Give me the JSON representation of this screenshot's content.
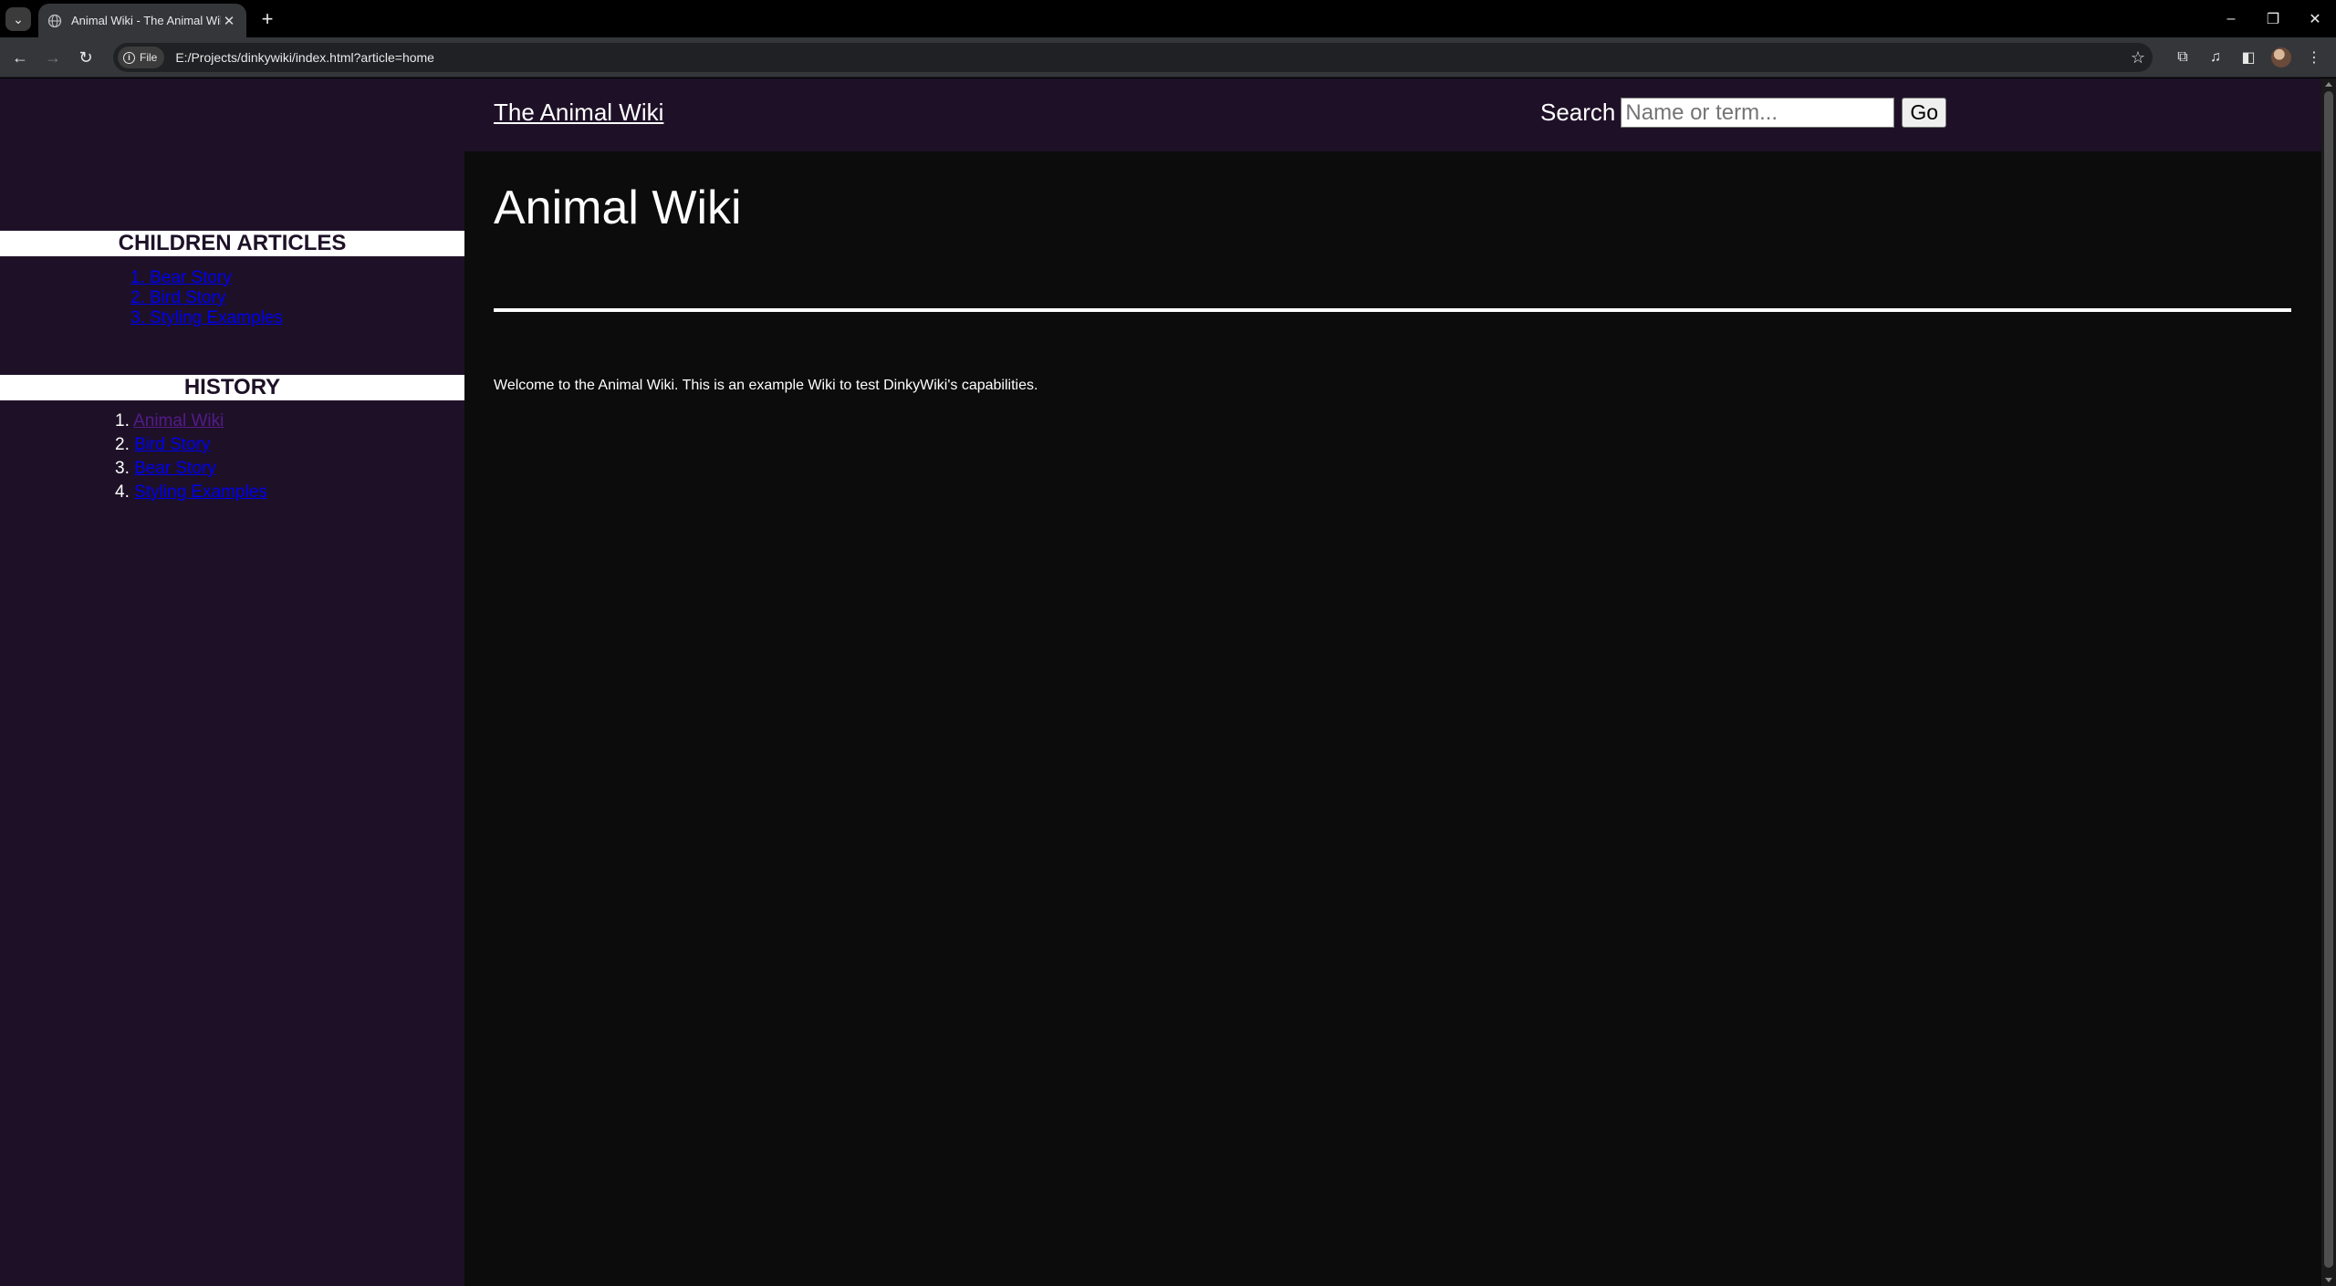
{
  "browser": {
    "tab_title": "Animal Wiki - The Animal Wiki",
    "tab_close": "✕",
    "new_tab": "+",
    "chip_label": "File",
    "url": "E:/Projects/dinkywiki/index.html?article=home",
    "icons": [
      "tab-list-icon",
      "globe-icon",
      "back-icon",
      "forward-icon",
      "reload-icon",
      "info-icon",
      "star-icon",
      "extensions-icon",
      "media-icon",
      "side-panel-icon",
      "profile-avatar",
      "menu-icon",
      "minimize-icon",
      "restore-icon",
      "close-icon"
    ]
  },
  "header": {
    "site_title": "The Animal Wiki",
    "search_label": "Search",
    "search_placeholder": "Name or term...",
    "search_value": "",
    "go_label": "Go"
  },
  "sidebar": {
    "children_heading": "CHILDREN ARTICLES",
    "children": [
      {
        "num": "1.",
        "label": "Bear Story"
      },
      {
        "num": "2.",
        "label": "Bird Story"
      },
      {
        "num": "3.",
        "label": "Styling Examples"
      }
    ],
    "history_heading": "HISTORY",
    "history": [
      {
        "num": "1.",
        "label": "Animal Wiki",
        "visited": true
      },
      {
        "num": "2.",
        "label": "Bird Story",
        "visited": false
      },
      {
        "num": "3.",
        "label": "Bear Story",
        "visited": false
      },
      {
        "num": "4.",
        "label": "Styling Examples",
        "visited": false
      }
    ]
  },
  "main": {
    "heading": "Animal Wiki",
    "body": "Welcome to the Animal Wiki. This is an example Wiki to test DinkyWiki's capabilities."
  },
  "colors": {
    "header_bg": "#1e1127",
    "sidebar_bg": "#1e1127",
    "content_bg": "#0c0c0c",
    "link": "#0000ee",
    "visited_link": "#551a8b"
  }
}
